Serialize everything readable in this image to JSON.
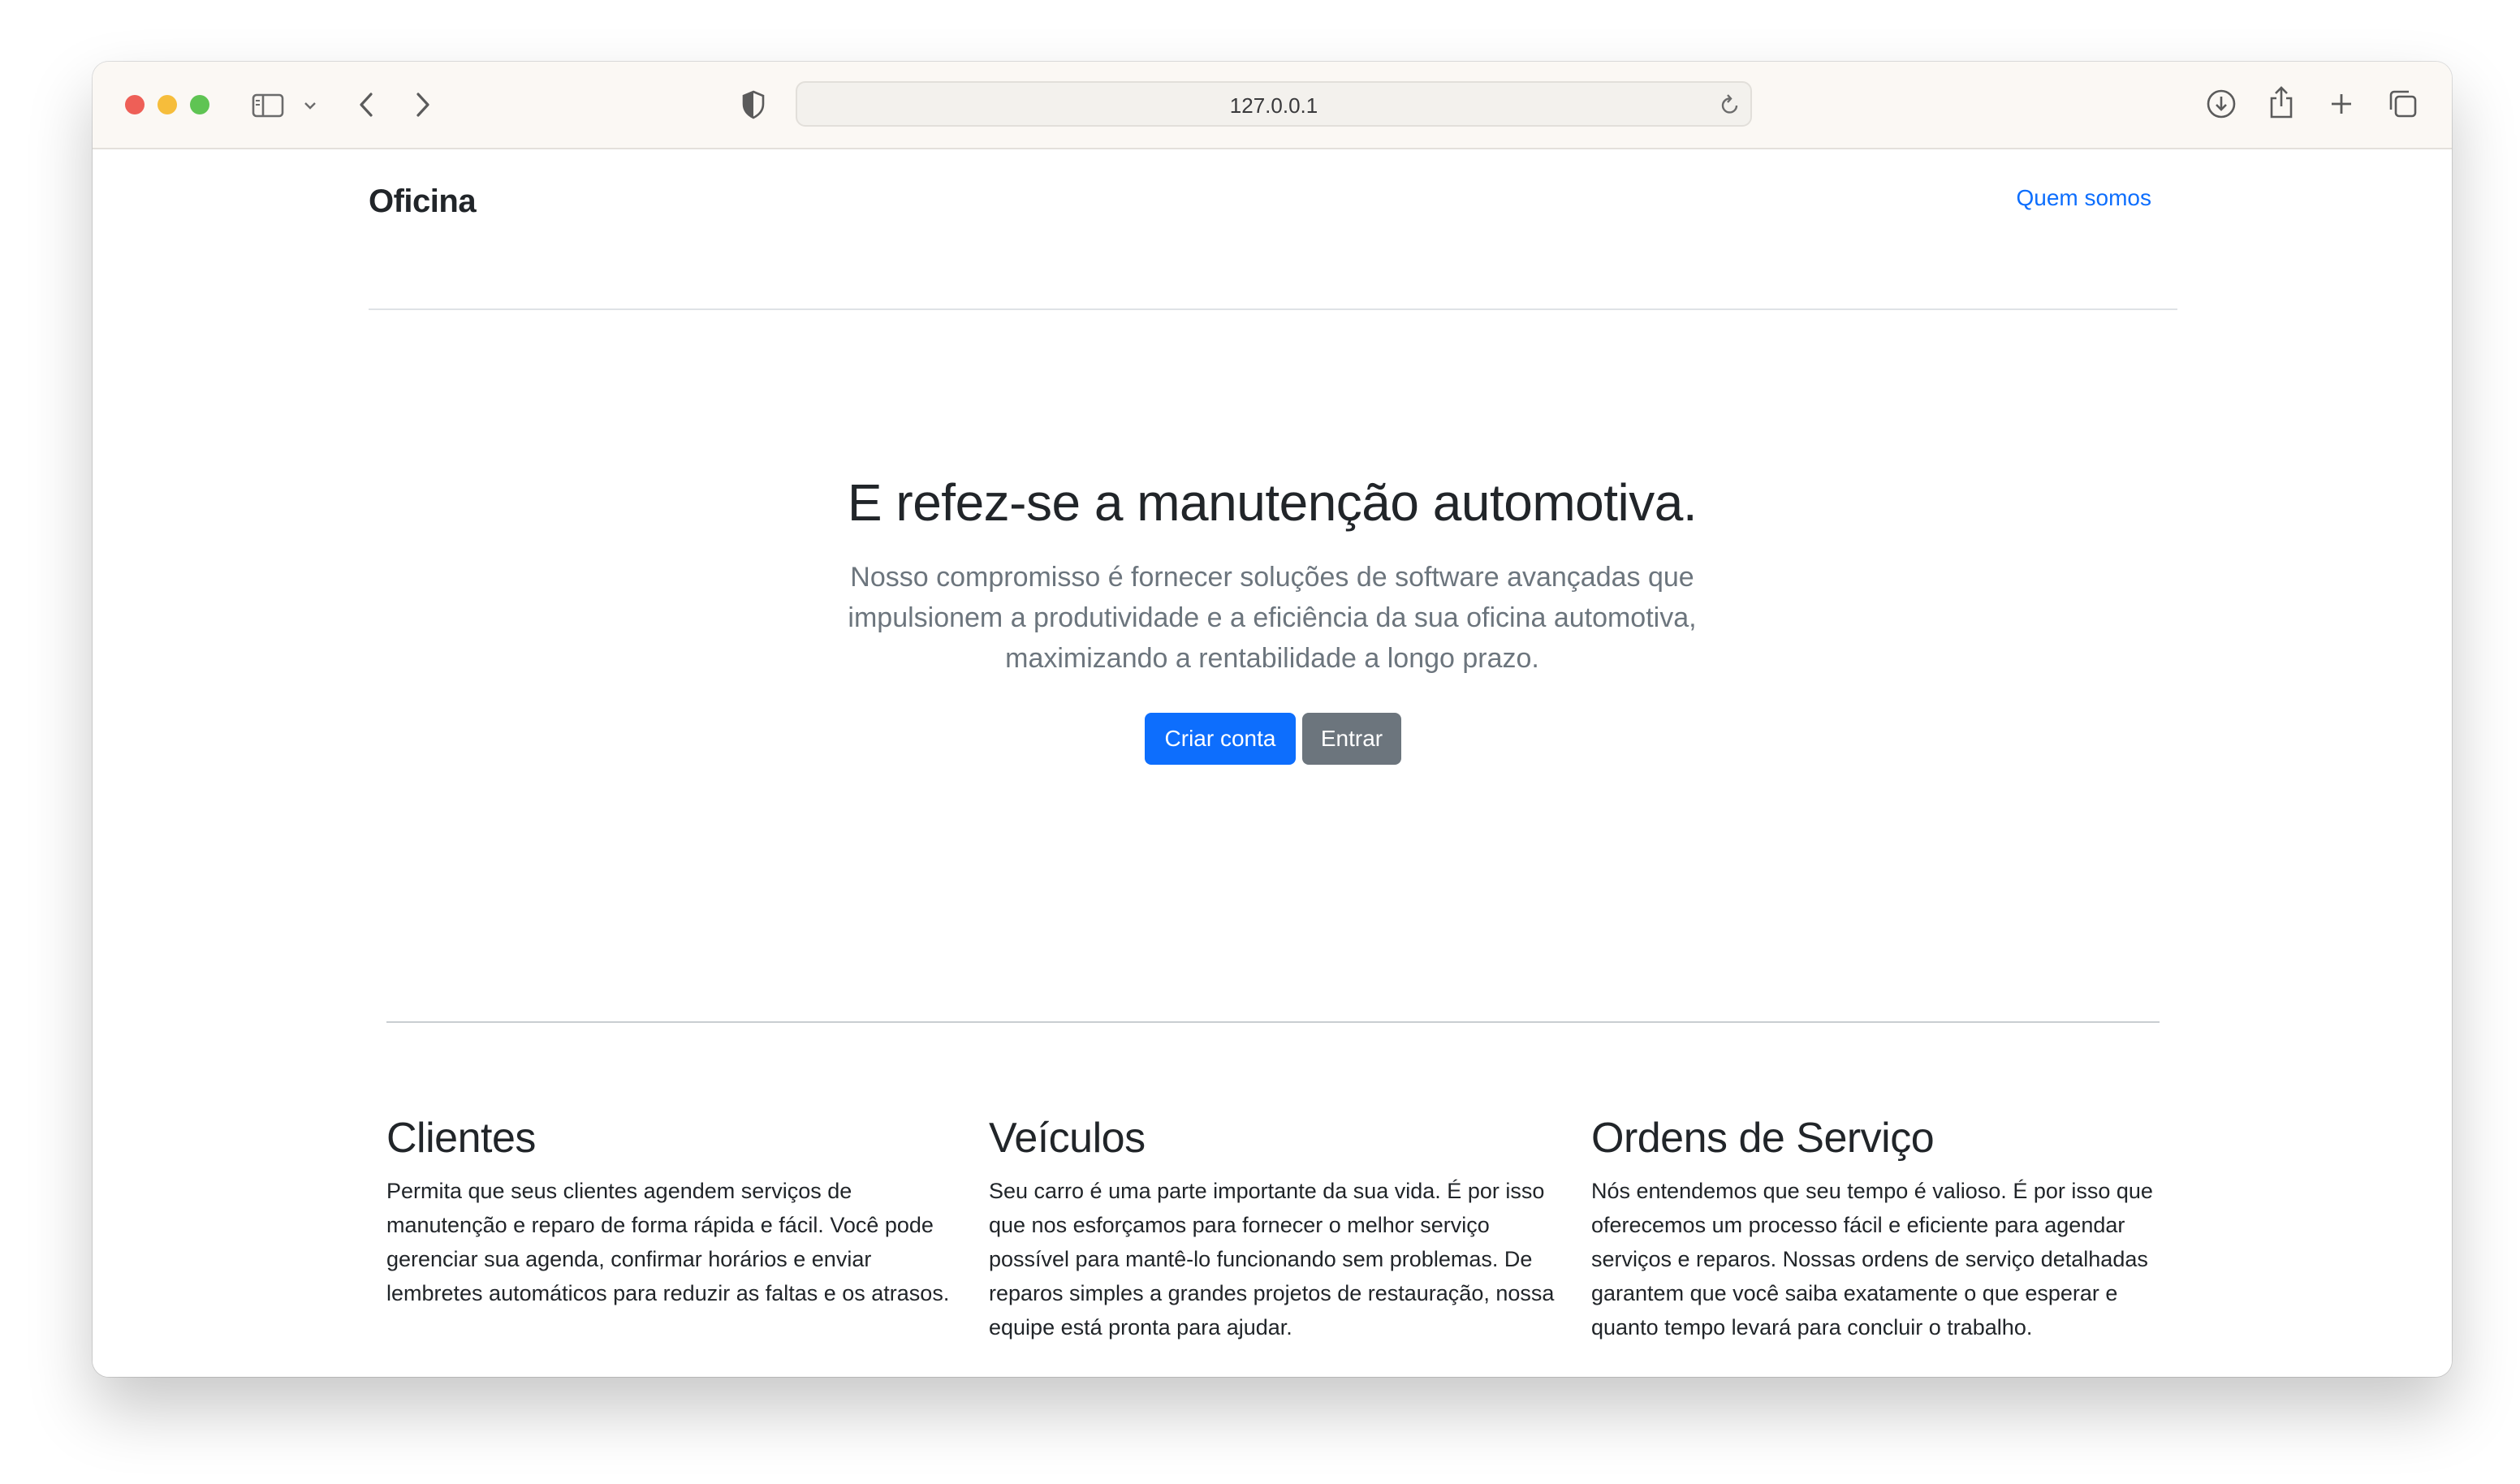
{
  "browser": {
    "url": "127.0.0.1",
    "traffic_lights": {
      "close": "#ee5f57",
      "minimize": "#f6bd3b",
      "maximize": "#5fc453"
    },
    "icons": [
      "sidebar-icon",
      "chevron-down-icon",
      "back-icon",
      "forward-icon",
      "privacy-shield-icon",
      "reload-icon",
      "download-icon",
      "share-icon",
      "new-tab-icon",
      "tabs-overview-icon"
    ]
  },
  "header": {
    "brand": "Oficina",
    "nav_link": "Quem somos"
  },
  "hero": {
    "title": "E refez-se a manutenção automotiva.",
    "lead": "Nosso compromisso é fornecer soluções de software avançadas que impulsionem a produtividade e a eficiência da sua oficina automotiva, maximizando a rentabilidade a longo prazo.",
    "primary_button": "Criar conta",
    "secondary_button": "Entrar"
  },
  "features": [
    {
      "title": "Clientes",
      "text": "Permita que seus clientes agendem serviços de manutenção e reparo de forma rápida e fácil. Você pode gerenciar sua agenda, confirmar horários e enviar lembretes automáticos para reduzir as faltas e os atrasos."
    },
    {
      "title": "Veículos",
      "text": "Seu carro é uma parte importante da sua vida. É por isso que nos esforçamos para fornecer o melhor serviço possível para mantê-lo funcionando sem problemas. De reparos simples a grandes projetos de restauração, nossa equipe está pronta para ajudar."
    },
    {
      "title": "Ordens de Serviço",
      "text": "Nós entendemos que seu tempo é valioso. É por isso que oferecemos um processo fácil e eficiente para agendar serviços e reparos. Nossas ordens de serviço detalhadas garantem que você saiba exatamente o que esperar e quanto tempo levará para concluir o trabalho."
    }
  ],
  "colors": {
    "primary": "#0d6efd",
    "secondary": "#6c757d",
    "text": "#212529",
    "muted": "#6c757d"
  }
}
